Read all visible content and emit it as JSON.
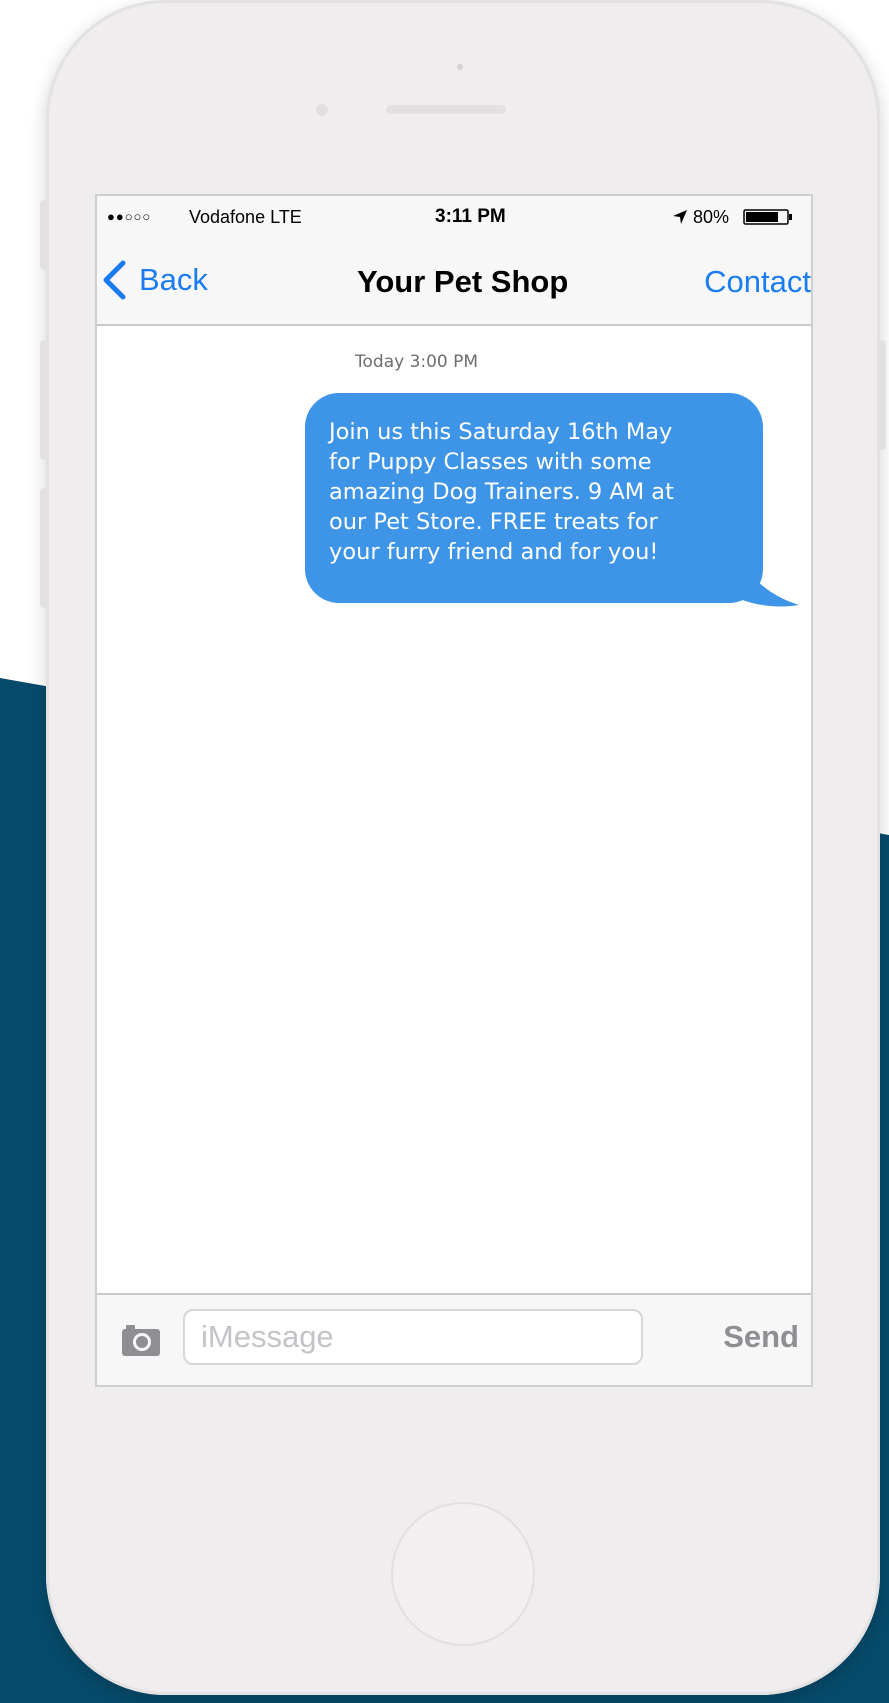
{
  "colors": {
    "background_navy": "#074b6c",
    "phone_body": "#efedee",
    "ios_blue": "#1a7cf0",
    "bubble_blue": "#3e95e8"
  },
  "status_bar": {
    "signal_dots": "●●○○○",
    "carrier": "Vodafone LTE",
    "time": "3:11 PM",
    "location_icon": "location-arrow-icon",
    "battery_percent": "80%",
    "battery_level": 0.8
  },
  "nav": {
    "back_label": "Back",
    "back_icon": "chevron-left-icon",
    "title": "Your Pet Shop",
    "contact_label": "Contact"
  },
  "conversation": {
    "timestamp": "Today 3:00 PM",
    "messages": [
      {
        "direction": "outgoing",
        "text": "Join us this Saturday 16th May\nfor Puppy Classes with some\namazing Dog Trainers. 9 AM at\nour Pet Store. FREE treats for\nyour furry friend and for you!"
      }
    ]
  },
  "composer": {
    "camera_icon": "camera-icon",
    "placeholder": "iMessage",
    "value": "",
    "send_label": "Send"
  }
}
